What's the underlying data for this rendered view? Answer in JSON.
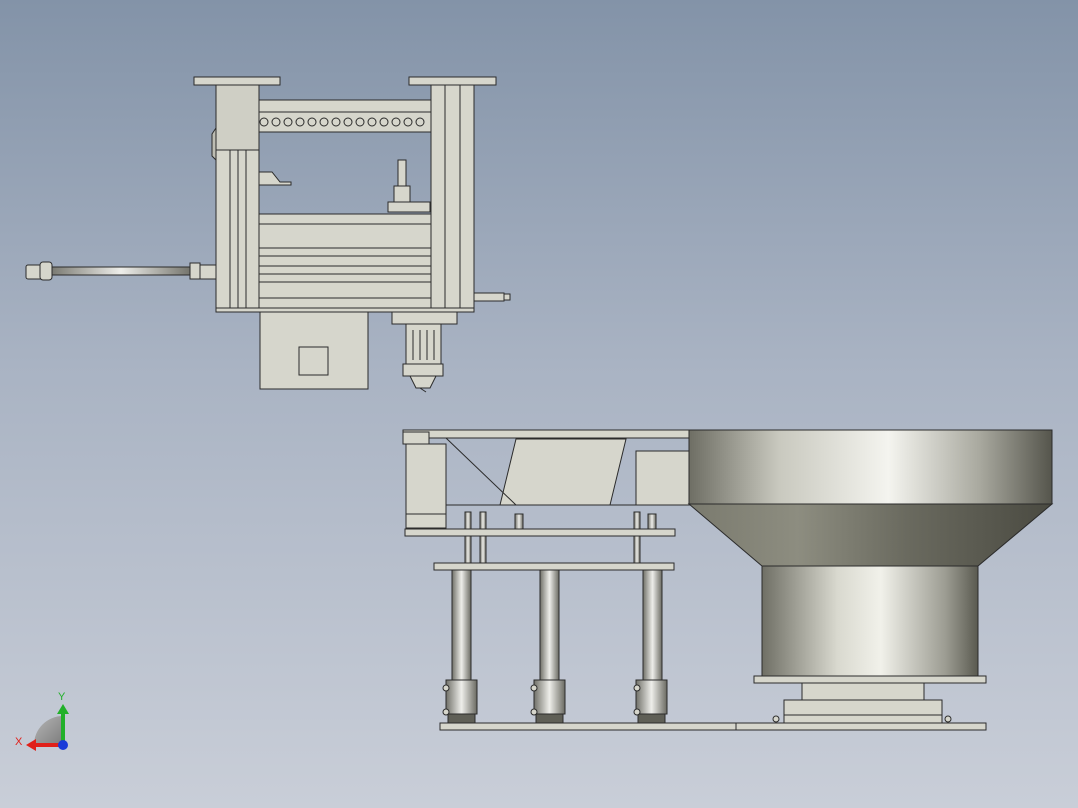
{
  "viewport": {
    "background_top": "#8393a8",
    "background_bottom": "#c9ced8"
  },
  "colors": {
    "part_fill": "#d6d6cc",
    "part_stroke": "#2b2b2b",
    "steel_light": "#f2f2ee",
    "steel_dark": "#5f5f56",
    "axis_x": "#e0201a",
    "axis_y": "#22b02a",
    "axis_z": "#1a3ad8"
  },
  "triad": {
    "x_label": "X",
    "y_label": "Y",
    "x_icon": "x-axis-arrow-icon",
    "y_icon": "y-axis-arrow-icon",
    "z_icon": "z-axis-dot-icon"
  }
}
